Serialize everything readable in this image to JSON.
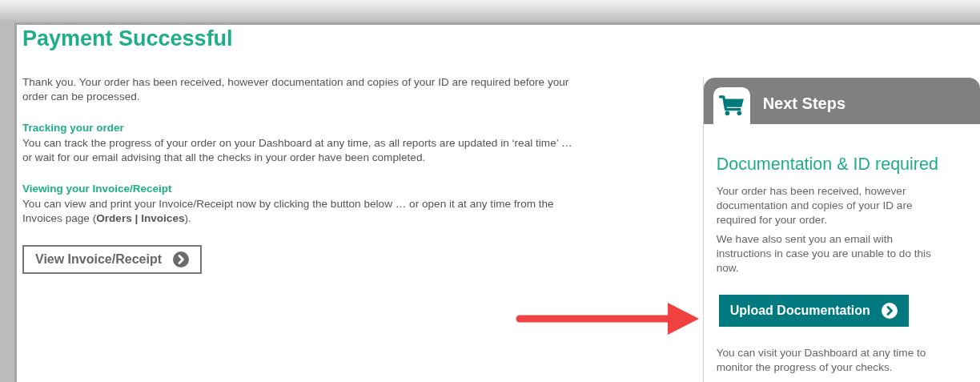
{
  "page": {
    "title": "Payment Successful",
    "intro": "Thank you. Your order has been received, however documentation and copies of your ID are required before your order can be processed.",
    "sections": [
      {
        "heading": "Tracking your order",
        "text": "You can track the progress of your order on your Dashboard at any time, as all reports are updated in ‘real time’ … or wait for our email advising that all the checks in your order have been completed."
      },
      {
        "heading": "Viewing your Invoice/Receipt",
        "text": "You can view and print your Invoice/Receipt now by clicking the button below … or open it at any time from the Invoices page (**Orders | Invoices**)."
      }
    ],
    "button": "View Invoice/Receipt"
  },
  "next_steps": {
    "title": "Next Steps",
    "heading": "Documentation & ID required",
    "paragraphs": [
      "Your order has been received, however documentation and copies of your ID are required for your order.",
      "We have also sent you an email with instructions in case you are unable to do this now."
    ],
    "button": "Upload Documentation",
    "footer": "You can visit your Dashboard at any time to monitor the progress of your checks."
  }
}
